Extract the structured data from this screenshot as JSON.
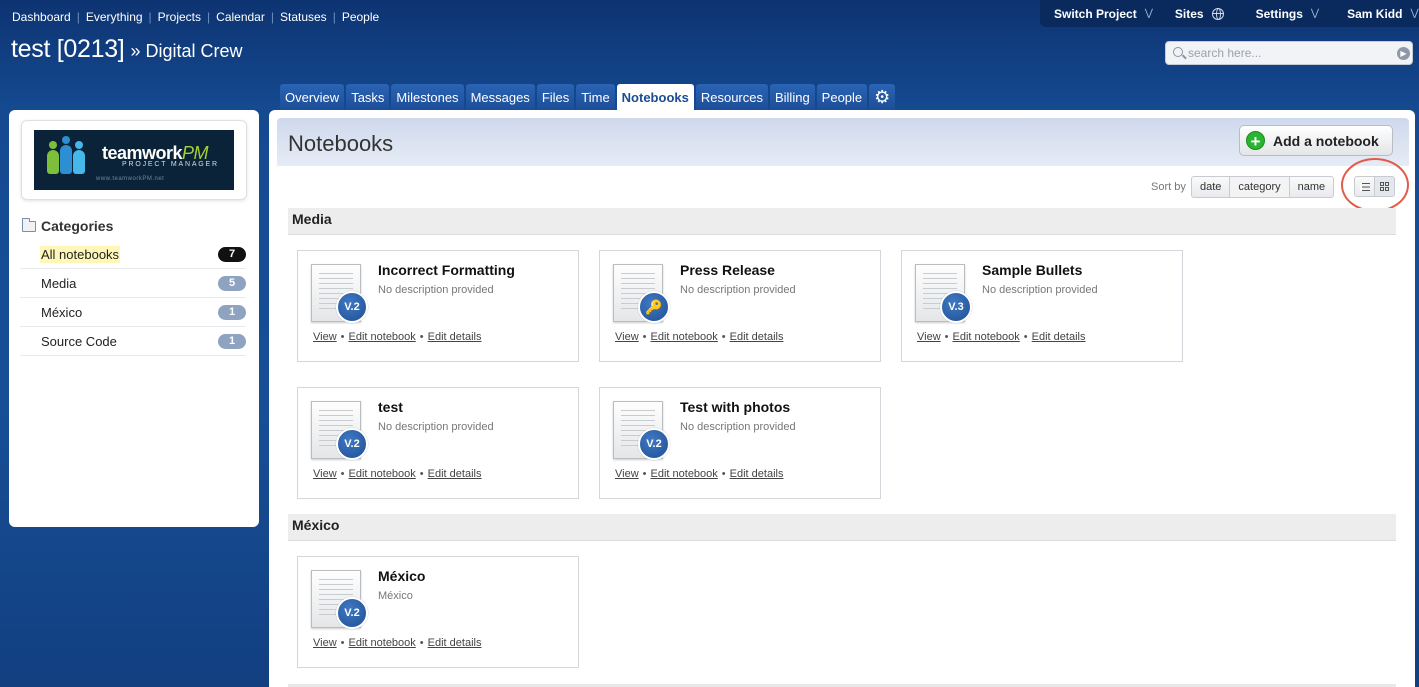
{
  "topnav": {
    "items": [
      "Dashboard",
      "Everything",
      "Projects",
      "Calendar",
      "Statuses",
      "People"
    ]
  },
  "rightnav": {
    "switch_project": "Switch Project",
    "sites": "Sites",
    "settings": "Settings",
    "user": "Sam Kidd"
  },
  "project": {
    "name": "test [0213]",
    "company": "» Digital Crew"
  },
  "search": {
    "placeholder": "search here..."
  },
  "tabs": [
    "Overview",
    "Tasks",
    "Milestones",
    "Messages",
    "Files",
    "Time",
    "Notebooks",
    "Resources",
    "Billing",
    "People"
  ],
  "active_tab": "Notebooks",
  "logo": {
    "word_a": "teamwork",
    "word_b": "PM",
    "sub": "PROJECT MANAGER",
    "url": "www.teamworkPM.net"
  },
  "sidebar": {
    "heading": "Categories",
    "items": [
      {
        "label": "All notebooks",
        "count": "7"
      },
      {
        "label": "Media",
        "count": "5"
      },
      {
        "label": "México",
        "count": "1"
      },
      {
        "label": "Source Code",
        "count": "1"
      }
    ]
  },
  "main": {
    "title": "Notebooks",
    "add_button": "Add a notebook",
    "sort_label": "Sort by",
    "sort_options": [
      "date",
      "category",
      "name"
    ],
    "sort_selected": "category"
  },
  "link_labels": {
    "view": "View",
    "edit_notebook": "Edit notebook",
    "edit_details": "Edit details"
  },
  "sections": [
    {
      "name": "Media",
      "notebooks": [
        {
          "title": "Incorrect Formatting",
          "description": "No description provided",
          "version": "V.2"
        },
        {
          "title": "Press Release",
          "description": "No description provided",
          "version": "key"
        },
        {
          "title": "Sample Bullets",
          "description": "No description provided",
          "version": "V.3"
        },
        {
          "title": "test",
          "description": "No description provided",
          "version": "V.2"
        },
        {
          "title": "Test with photos",
          "description": "No description provided",
          "version": "V.2"
        }
      ]
    },
    {
      "name": "México",
      "notebooks": [
        {
          "title": "México",
          "description": "México",
          "version": "V.2"
        }
      ]
    }
  ],
  "colors": {
    "accent": "#1b4c93",
    "add_green": "#2bb431",
    "highlight_circle": "#e25b4a"
  }
}
